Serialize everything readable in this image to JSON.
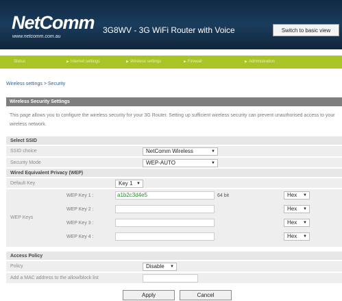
{
  "header": {
    "logo": "NetComm",
    "logo_url": "www.netcomm.com.au",
    "title": "3G8WV - 3G WiFi Router with Voice",
    "switch_button": "Switch to basic view"
  },
  "nav": {
    "items": [
      {
        "label": "Status",
        "arrow": ""
      },
      {
        "label": "Internet settings",
        "arrow": "▶"
      },
      {
        "label": "Wireless settings",
        "arrow": "▶"
      },
      {
        "label": "Firewall",
        "arrow": "▶"
      },
      {
        "label": "Administration",
        "arrow": "▶"
      }
    ]
  },
  "breadcrumb": "Wireless settings > Security",
  "section": {
    "title": "Wireless Security Settings",
    "description": "This page allows you to configure the wireless security for your 3G Router. Setting up sufficient wireless security can prevent unauthorised access to your wireless network."
  },
  "ssid": {
    "heading": "Select SSID",
    "choice_label": "SSID choice",
    "choice_value": "NetComm Wireless",
    "mode_label": "Security Mode",
    "mode_value": "WEP-AUTO"
  },
  "wep": {
    "heading": "Wired Equivalent Privacy (WEP)",
    "default_key_label": "Default Key",
    "default_key_value": "Key 1",
    "keys_label": "WEP Keys",
    "keys": [
      {
        "label": "WEP Key 1 :",
        "value": "a1b2c3d4e5",
        "bits": "64 bit",
        "format": "Hex"
      },
      {
        "label": "WEP Key 2 :",
        "value": "",
        "bits": "",
        "format": "Hex"
      },
      {
        "label": "WEP Key 3 :",
        "value": "",
        "bits": "",
        "format": "Hex"
      },
      {
        "label": "WEP Key 4 :",
        "value": "",
        "bits": "",
        "format": "Hex"
      }
    ]
  },
  "access": {
    "heading": "Access Policy",
    "policy_label": "Policy",
    "policy_value": "Disable",
    "mac_label": "Add a MAC address to the allow/block list",
    "mac_value": ""
  },
  "buttons": {
    "apply": "Apply",
    "cancel": "Cancel"
  },
  "icons": {
    "dropdown": "chevron-down-icon",
    "nav_arrow": "arrow-right-icon"
  },
  "colors": {
    "header_bg": "#1a3c5c",
    "nav_bg": "#a9c425",
    "section_header_bg": "#7e7e7e",
    "row_bg": "#eeeeee",
    "link": "#2a5c8f",
    "key_value": "#2a8a2a"
  }
}
